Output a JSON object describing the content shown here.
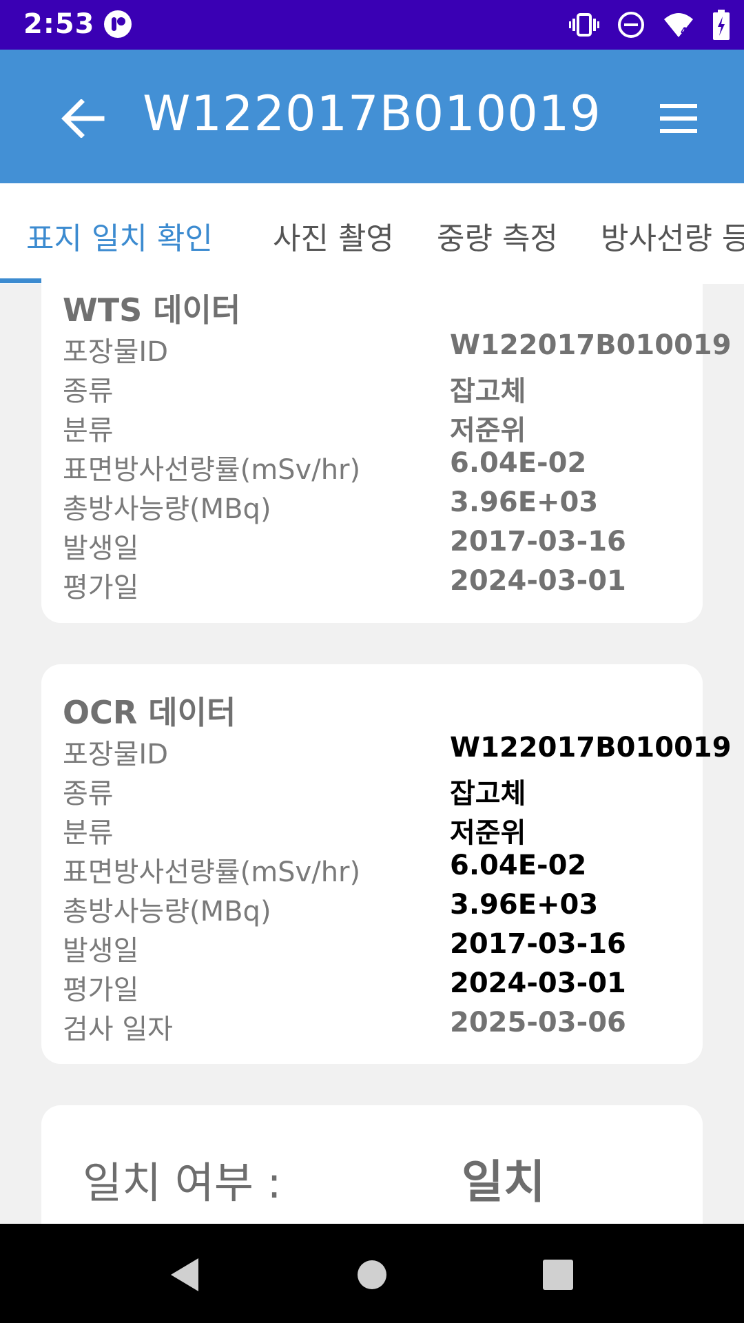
{
  "status_bar": {
    "time": "2:53",
    "icons": [
      "app-notification-icon",
      "vibrate-icon",
      "do-not-disturb-icon",
      "wifi-icon",
      "battery-charging-icon"
    ]
  },
  "app_bar": {
    "title": "W122017B010019",
    "back_icon": "arrow-back-icon",
    "menu_icon": "hamburger-menu-icon",
    "background": "#4390d5"
  },
  "tabs": [
    {
      "label": "표지 일치 확인",
      "active": true
    },
    {
      "label": "사진 촬영",
      "active": false
    },
    {
      "label": "중량 측정",
      "active": false
    },
    {
      "label": "방사선량 등록",
      "active": false
    }
  ],
  "wts": {
    "title": "WTS 데이터",
    "rows": [
      {
        "label": "포장물ID",
        "value": "W122017B010019"
      },
      {
        "label": "종류",
        "value": "잡고체"
      },
      {
        "label": "분류",
        "value": "저준위"
      },
      {
        "label": "표면방사선량률(mSv/hr)",
        "value": "6.04E-02"
      },
      {
        "label": "총방사능량(MBq)",
        "value": "3.96E+03"
      },
      {
        "label": "발생일",
        "value": "2017-03-16"
      },
      {
        "label": "평가일",
        "value": "2024-03-01"
      }
    ]
  },
  "ocr": {
    "title": "OCR 데이터",
    "rows": [
      {
        "label": "포장물ID",
        "value": "W122017B010019"
      },
      {
        "label": "종류",
        "value": "잡고체"
      },
      {
        "label": "분류",
        "value": "저준위"
      },
      {
        "label": "표면방사선량률(mSv/hr)",
        "value": "6.04E-02"
      },
      {
        "label": "총방사능량(MBq)",
        "value": "3.96E+03"
      },
      {
        "label": "발생일",
        "value": "2017-03-16"
      },
      {
        "label": "평가일",
        "value": "2024-03-01"
      },
      {
        "label": "검사 일자",
        "value": "2025-03-06"
      }
    ]
  },
  "match": {
    "label": "일치 여부 :",
    "value": "일치"
  },
  "colors": {
    "status_bar": "#3a00b4",
    "accent": "#3c8bd0"
  }
}
